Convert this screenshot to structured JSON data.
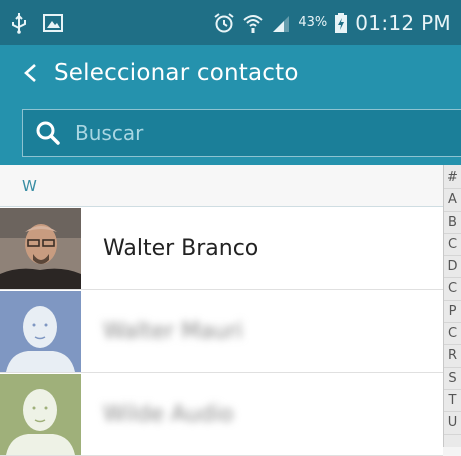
{
  "status_bar": {
    "battery_percent": "43%",
    "time": "01:12 PM",
    "icons": [
      "usb-icon",
      "gallery-icon",
      "alarm-icon",
      "wifi-icon",
      "signal-icon",
      "battery-charging-icon"
    ]
  },
  "header": {
    "title": "Seleccionar contacto"
  },
  "search": {
    "placeholder": "Buscar"
  },
  "list": {
    "section_letter": "W",
    "contacts": [
      {
        "name": "Walter Branco",
        "avatar": "photo"
      },
      {
        "name": "Walter Mauri",
        "avatar": "default-blue"
      },
      {
        "name": "Wilde Audio",
        "avatar": "default-green"
      }
    ]
  },
  "index": [
    "#",
    "A",
    "B",
    "C",
    "D",
    "C",
    "P",
    "C",
    "R",
    "S",
    "T",
    "U"
  ],
  "colors": {
    "status_bar": "#1f6f86",
    "header": "#2592ad",
    "section_text": "#3a8ea4",
    "avatar_blue": "#7f97c2",
    "avatar_green": "#9fb07a"
  }
}
